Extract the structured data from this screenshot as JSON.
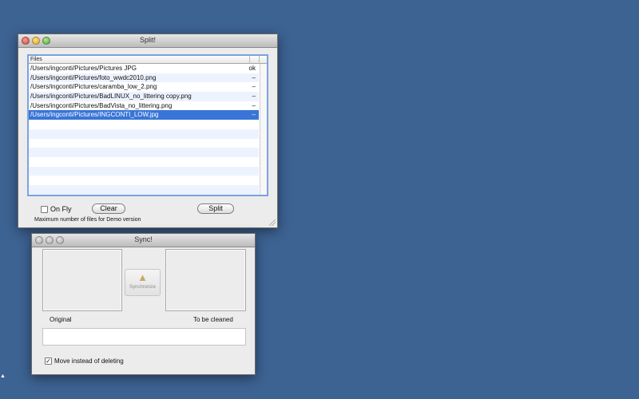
{
  "split_window": {
    "title": "Split!",
    "table": {
      "header": "Files",
      "rows": [
        {
          "path": "/Users/ingconti/Pictures/Pictures JPG",
          "status": "ok"
        },
        {
          "path": "/Users/ingconti/Pictures/foto_wwdc2010.png",
          "status": "–"
        },
        {
          "path": "/Users/ingconti/Pictures/caramba_low_2.png",
          "status": "–"
        },
        {
          "path": "/Users/ingconti/Pictures/BadLINUX_no_littering copy.png",
          "status": "–"
        },
        {
          "path": "/Users/ingconti/Pictures/BadVista_no_littering.png",
          "status": "–"
        },
        {
          "path": "/Users/ingconti/Pictures/INGCONTI_LOW.jpg",
          "status": "–"
        }
      ]
    },
    "on_fly_label": "On Fly",
    "clear_label": "Clear",
    "split_label": "Split",
    "demo_note": "Maximum number of files for Demo version"
  },
  "sync_window": {
    "title": "Sync!",
    "synchronize_label": "Synchronize",
    "original_label": "Original",
    "to_be_cleaned_label": "To be cleaned",
    "move_label": "Move instead of deleting",
    "move_checked": true
  },
  "colors": {
    "desktop": "#3d6393",
    "selection": "#3875d7",
    "stripe": "#edf3fe"
  }
}
